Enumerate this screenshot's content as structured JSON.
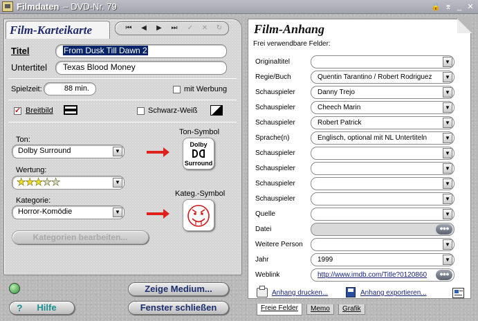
{
  "window": {
    "title": "Filmdaten",
    "subtitle": "– DVD-Nr. 79"
  },
  "karteikarte": {
    "tab_title": "Film-Karteikarte",
    "titel_label": "Titel",
    "titel_value": "From Dusk Till Dawn 2",
    "untertitel_label": "Untertitel",
    "untertitel_value": "Texas Blood Money",
    "spielzeit_label": "Spielzeit:",
    "spielzeit_value": "88 min.",
    "werbung_label": "mit Werbung",
    "breitbild_label": "Breitbild",
    "breitbild_checked": true,
    "sw_label": "Schwarz-Weiß",
    "ton_label": "Ton:",
    "ton_value": "Dolby Surround",
    "ton_symbol_label": "Ton-Symbol",
    "dolby_top": "Dolby",
    "dolby_bottom": "Surround",
    "wertung_label": "Wertung:",
    "wertung_stars": 3,
    "wertung_max": 5,
    "kategorie_label": "Kategorie:",
    "kategorie_value": "Horror-Komödie",
    "kateg_symbol_label": "Kateg.-Symbol",
    "kategorien_button": "Kategorien bearbeiten..."
  },
  "buttons": {
    "zeige_medium": "Zeige Medium...",
    "hilfe": "Hilfe",
    "fenster_schliessen": "Fenster schließen"
  },
  "anhang": {
    "title": "Film-Anhang",
    "subtitle": "Frei verwendbare Felder:",
    "fields": [
      {
        "label": "Originaltitel",
        "value": "",
        "type": "combo"
      },
      {
        "label": "Regie/Buch",
        "value": "Quentin Tarantino / Robert Rodriguez",
        "type": "combo"
      },
      {
        "label": "Schauspieler",
        "value": "Danny Trejo",
        "type": "combo"
      },
      {
        "label": "Schauspieler",
        "value": "Cheech Marin",
        "type": "combo"
      },
      {
        "label": "Schauspieler",
        "value": "Robert Patrick",
        "type": "combo"
      },
      {
        "label": "Sprache(n)",
        "value": "Englisch, optional mit NL Untertiteln",
        "type": "combo"
      },
      {
        "label": "Schauspieler",
        "value": "",
        "type": "combo"
      },
      {
        "label": "Schauspieler",
        "value": "",
        "type": "combo"
      },
      {
        "label": "Schauspieler",
        "value": "",
        "type": "combo"
      },
      {
        "label": "Schauspieler",
        "value": "",
        "type": "combo"
      },
      {
        "label": "Quelle",
        "value": "",
        "type": "combo"
      },
      {
        "label": "Datei",
        "value": "",
        "type": "file"
      },
      {
        "label": "Weitere Person",
        "value": "",
        "type": "combo"
      },
      {
        "label": "Jahr",
        "value": "1999",
        "type": "combo"
      },
      {
        "label": "Weblink",
        "value": "http://www.imdb.com/Title?0120860",
        "type": "link"
      }
    ],
    "drucken_label": "Anhang drucken...",
    "exportieren_label": "Anhang exportieren...",
    "tabs": [
      "Freie Felder",
      "Memo",
      "Grafik"
    ]
  }
}
